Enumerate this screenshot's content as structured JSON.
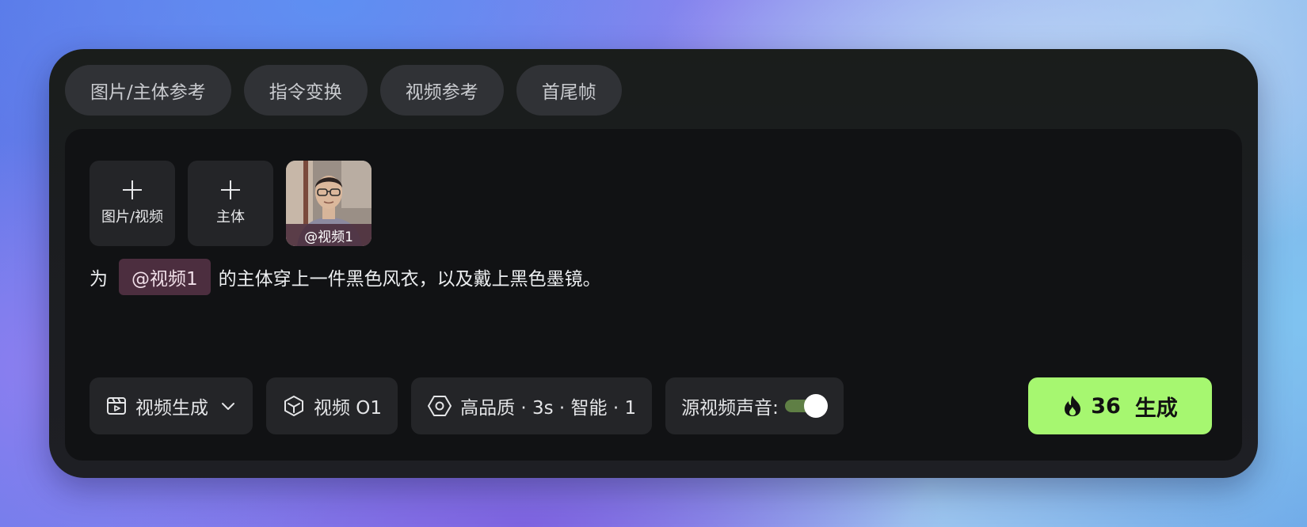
{
  "tabs": [
    "图片/主体参考",
    "指令变换",
    "视频参考",
    "首尾帧"
  ],
  "uploads": {
    "media_label": "图片/视频",
    "subject_label": "主体",
    "thumbnail_label": "@视频1"
  },
  "prompt": {
    "prefix": "为",
    "mention": "@视频1",
    "suffix": "的主体穿上一件黑色风衣，以及戴上黑色墨镜。"
  },
  "toolbar": {
    "mode_label": "视频生成",
    "model_label": "视频 O1",
    "settings_label": "高品质 · 3s · 智能 · 1",
    "audio_label": "源视频声音:",
    "audio_enabled": true
  },
  "generate": {
    "cost": "36",
    "label": "生成"
  },
  "colors": {
    "accent": "#a6f770",
    "mention_bg": "#4c2e3f",
    "toggle_on": "#5f7f45"
  }
}
